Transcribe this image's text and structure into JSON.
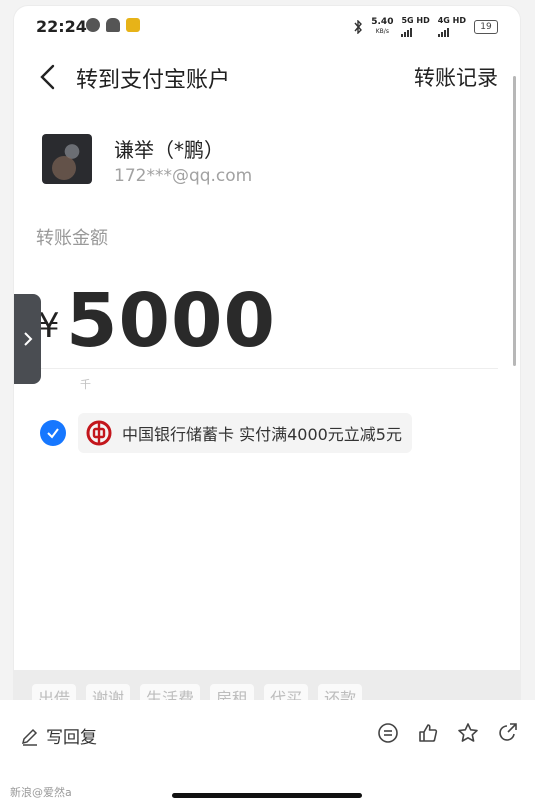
{
  "status": {
    "time": "22:24",
    "speed_value": "5.40",
    "speed_unit": "KB/s",
    "net1": "5G HD",
    "net2": "4G HD",
    "battery": "19"
  },
  "nav": {
    "title": "转到支付宝账户",
    "history_link": "转账记录"
  },
  "recipient": {
    "name": "谦举（*鹏）",
    "account": "172***@qq.com"
  },
  "amount": {
    "label": "转账金额",
    "currency": "¥",
    "value": "5000",
    "unit_hint": "千"
  },
  "payment": {
    "method": "中国银行储蓄卡 实付满4000元立减5元",
    "accent": "#1677ff",
    "bank_color": "#c3161c"
  },
  "quick_tags": [
    "出借",
    "谢谢",
    "生活费",
    "房租",
    "代买",
    "还款"
  ],
  "footer": {
    "reply_label": "写回复",
    "watermark": "新浪@爱然a"
  }
}
